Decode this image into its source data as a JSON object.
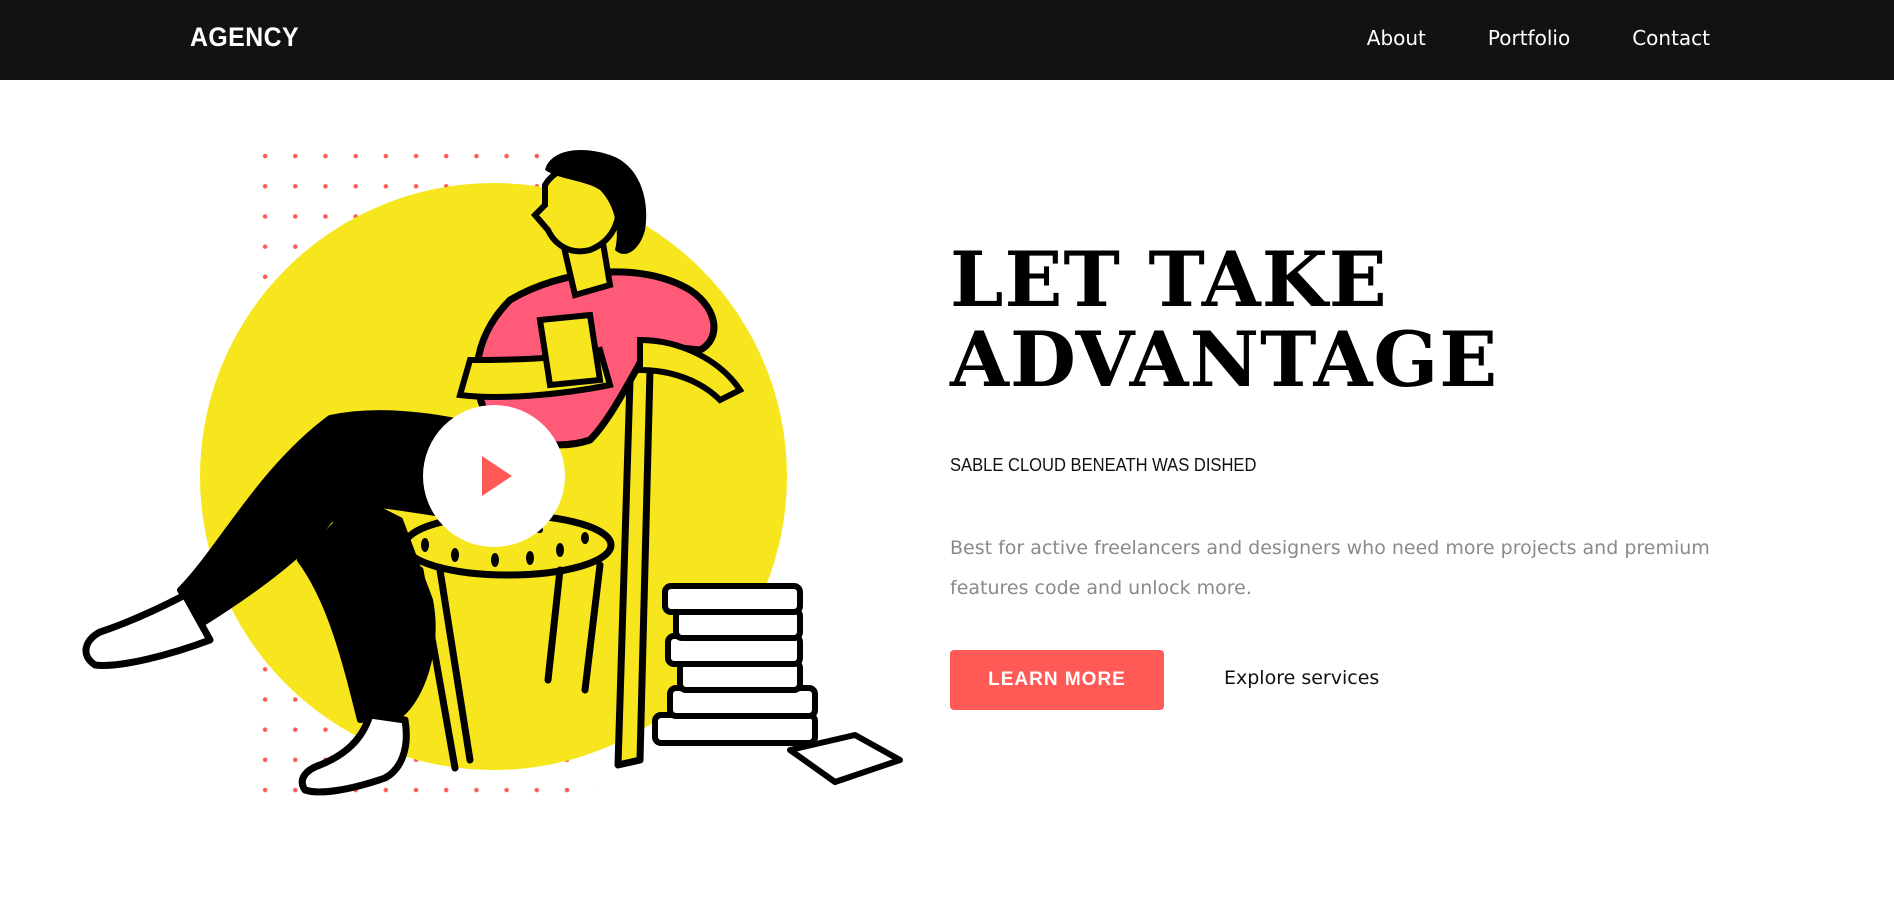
{
  "header": {
    "brand": "AGENCY",
    "nav": [
      {
        "label": "About"
      },
      {
        "label": "Portfolio"
      },
      {
        "label": "Contact"
      }
    ]
  },
  "hero": {
    "title_line1": "LET TAKE",
    "title_line2": "ADVANTAGE",
    "subtitle": "SABLE CLOUD BENEATH WAS DISHED",
    "description": "Best for active freelancers and designers who need more projects and premium features code and unlock more.",
    "primary_cta": "LEARN MORE",
    "secondary_cta": "Explore services",
    "video_button_icon": "play-icon"
  },
  "colors": {
    "topbar": "#121212",
    "accent": "#ff5a55",
    "sun": "#f7e61e",
    "shirt": "#ff5a78",
    "text_muted": "#8a8a8a"
  }
}
